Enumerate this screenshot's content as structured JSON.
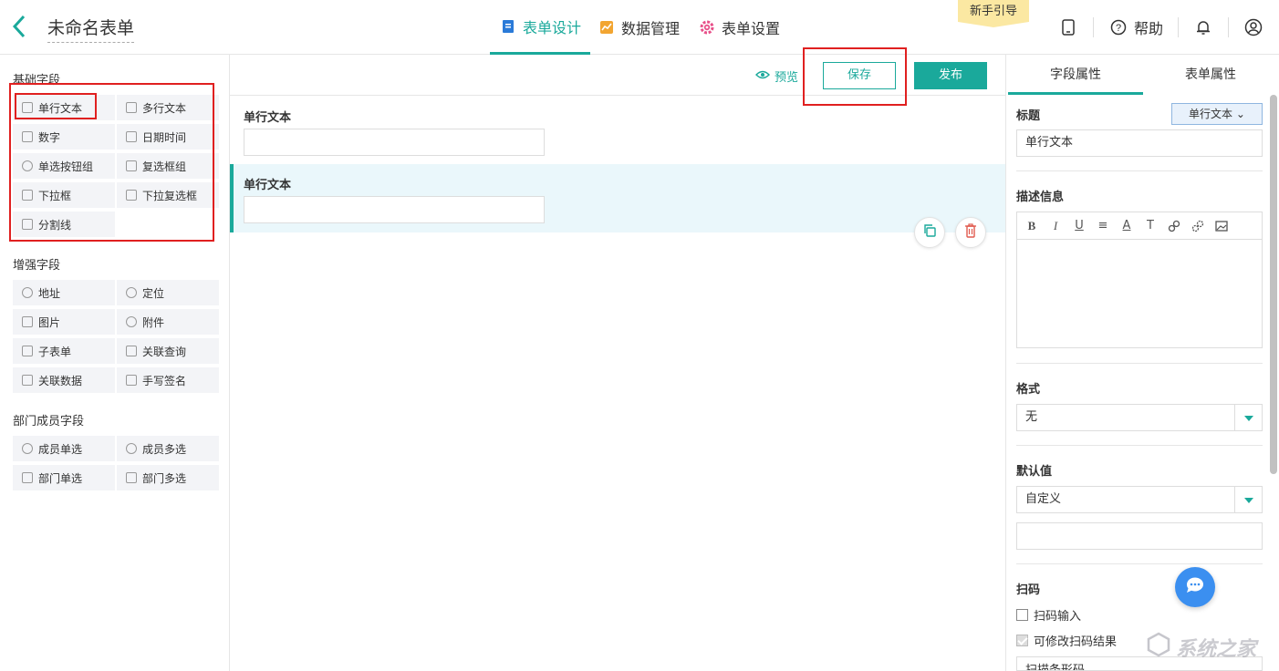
{
  "header": {
    "form_title": "未命名表单",
    "tabs": [
      {
        "label": "表单设计",
        "icon": "document-icon",
        "active": true
      },
      {
        "label": "数据管理",
        "icon": "chart-icon",
        "active": false
      },
      {
        "label": "表单设置",
        "icon": "gear-icon",
        "active": false
      }
    ],
    "guide_badge": "新手引导",
    "help_label": "帮助"
  },
  "left_panel": {
    "basic_title": "基础字段",
    "basic_fields": [
      "单行文本",
      "多行文本",
      "数字",
      "日期时间",
      "单选按钮组",
      "复选框组",
      "下拉框",
      "下拉复选框",
      "分割线"
    ],
    "enhanced_title": "增强字段",
    "enhanced_fields": [
      "地址",
      "定位",
      "图片",
      "附件",
      "子表单",
      "关联查询",
      "关联数据",
      "手写签名"
    ],
    "member_title": "部门成员字段",
    "member_fields": [
      "成员单选",
      "成员多选",
      "部门单选",
      "部门多选"
    ]
  },
  "center": {
    "preview_label": "预览",
    "save_label": "保存",
    "publish_label": "发布",
    "items": [
      {
        "label": "单行文本"
      },
      {
        "label": "单行文本"
      }
    ]
  },
  "right_panel": {
    "tabs": [
      "字段属性",
      "表单属性"
    ],
    "title_label": "标题",
    "type_dropdown": "单行文本",
    "title_value": "单行文本",
    "desc_label": "描述信息",
    "editor_tools": [
      "B",
      "I",
      "U",
      "≡",
      "A",
      "T",
      "link",
      "unlink",
      "image"
    ],
    "format_label": "格式",
    "format_value": "无",
    "default_label": "默认值",
    "default_value": "自定义",
    "scan_label": "扫码",
    "scan_input": "扫码输入",
    "scan_edit": "可修改扫码结果",
    "scan_type_partial": "扫描条形码"
  },
  "watermark": "系统之家",
  "colors": {
    "accent": "#1aa99b",
    "annotation": "#e02020",
    "chat": "#3b8ff0"
  }
}
